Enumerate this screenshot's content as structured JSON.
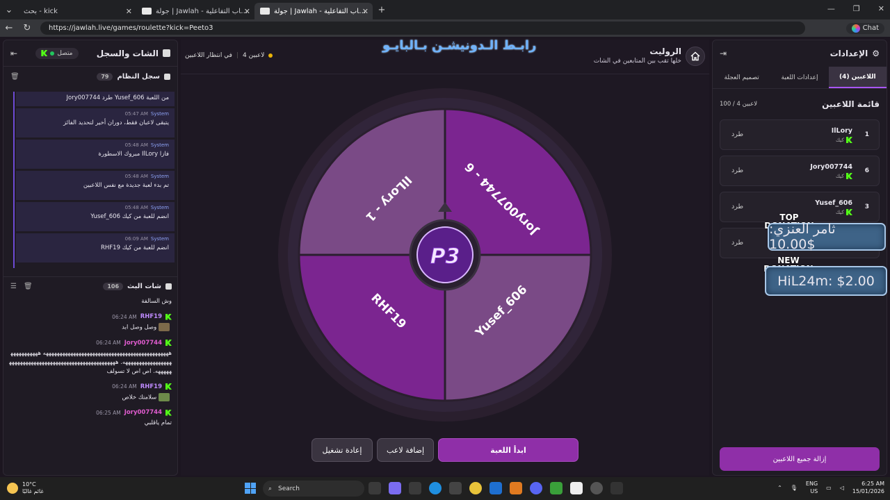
{
  "browser": {
    "tabs": [
      {
        "title": "بحث - kick",
        "active": false
      },
      {
        "title": "جولة | Jawlah - منصة الألعاب التفاعلية",
        "active": false
      },
      {
        "title": "جولة | Jawlah - منصة الألعاب التفاعلية",
        "active": true
      }
    ],
    "url": "https://jawlah.live/games/roulette?kick=Peeto3",
    "chat_label": "Chat"
  },
  "left_panel": {
    "title": "الشات والسجل",
    "status": "متصل",
    "system_log": {
      "title": "سجل النظام",
      "count": "79",
      "messages": [
        {
          "sender": "",
          "time": "",
          "text": "Jory007744 طرد Yusef_606 من اللعبة"
        },
        {
          "sender": "System",
          "time": "05:47 AM",
          "text": "يتبقى لاعبان فقط، دوران أخير لتحديد الفائز"
        },
        {
          "sender": "System",
          "time": "05:48 AM",
          "text": "مبروك الاسطورة IlLory فازا"
        },
        {
          "sender": "System",
          "time": "05:48 AM",
          "text": "تم بدء لعبة جديدة مع نفس اللاعبين"
        },
        {
          "sender": "System",
          "time": "05:48 AM",
          "text": "Yusef_606 انضم للعبة من كيك"
        },
        {
          "sender": "System",
          "time": "06:09 AM",
          "text": "RHF19 انضم للعبة من كيك"
        }
      ]
    },
    "stream_chat": {
      "title": "شات البث",
      "count": "106",
      "messages": [
        {
          "user": "",
          "time": "",
          "color": "",
          "text": "وش السالفة"
        },
        {
          "user": "RHF19",
          "time": "06:24 AM",
          "color": "#c08bff",
          "text": "وصل وصل ابد",
          "emote": true
        },
        {
          "user": "Jory007744",
          "time": "06:24 AM",
          "color": "#e05ccf",
          "text": "ههههههههههههههههههههههههههههههههههههههههههههههه ههههههههههههههههههههههههههههه. هههههههههههههههههههههههههههههههههههههههههههههه. اص اص لا تسولف"
        },
        {
          "user": "RHF19",
          "time": "06:24 AM",
          "color": "#c08bff",
          "text": "سلامتك خلاص",
          "emote": true
        },
        {
          "user": "Jory007744",
          "time": "06:25 AM",
          "color": "#e05ccf",
          "text": "تمام ياقلبي"
        }
      ]
    }
  },
  "center": {
    "banner": "رابـط الـدونيشـن بـالبايـو",
    "players_count": "4 لاعبين",
    "waiting": "في انتظار اللاعبين",
    "game_title": "الروليت",
    "game_subtitle": "خلها تقب بين المتابعين في الشات",
    "wheel_center_text": "P3",
    "wheel_segments": [
      {
        "label": "IlLory - 1",
        "color": "#7a4a86"
      },
      {
        "label": "Jory007744 - 6",
        "color": "#7b2590"
      },
      {
        "label": "Yusef_606",
        "color": "#7a4a86"
      },
      {
        "label": "RHF19",
        "color": "#7b2590"
      }
    ],
    "buttons": {
      "start": "ابدأ اللعبة",
      "add_player": "إضافة لاعب",
      "restart": "إعادة تشغيل"
    }
  },
  "right_panel": {
    "title": "الإعدادات",
    "tabs": [
      "اللاعبين (4)",
      "إعدادات اللعبة",
      "تصميم العجلة"
    ],
    "list_title": "قائمة اللاعبين",
    "list_count": "100 / 4 لاعبين",
    "players": [
      {
        "number": "1",
        "name": "IlLory",
        "source": "كيك",
        "action": "طرد"
      },
      {
        "number": "6",
        "name": "Jory007744",
        "source": "كيك",
        "action": "طرد"
      },
      {
        "number": "3",
        "name": "Yusef_606",
        "source": "كيك",
        "action": "طرد"
      },
      {
        "number": "",
        "name": "",
        "source": "",
        "action": "طرد"
      }
    ],
    "remove_all": "إزالة جميع اللاعبين"
  },
  "donations": {
    "top_label": "TOP DONATION",
    "top_value": "ثامر العنزي: $10.00",
    "new_label": "NEW DONATION",
    "new_value": "HiL24m: $2.00"
  },
  "taskbar": {
    "weather_temp": "10°C",
    "weather_desc": "غائم غالبًا",
    "search_placeholder": "Search",
    "lang": "ENG",
    "region": "US",
    "time": "6:25 AM",
    "date": "15/01/2026"
  }
}
